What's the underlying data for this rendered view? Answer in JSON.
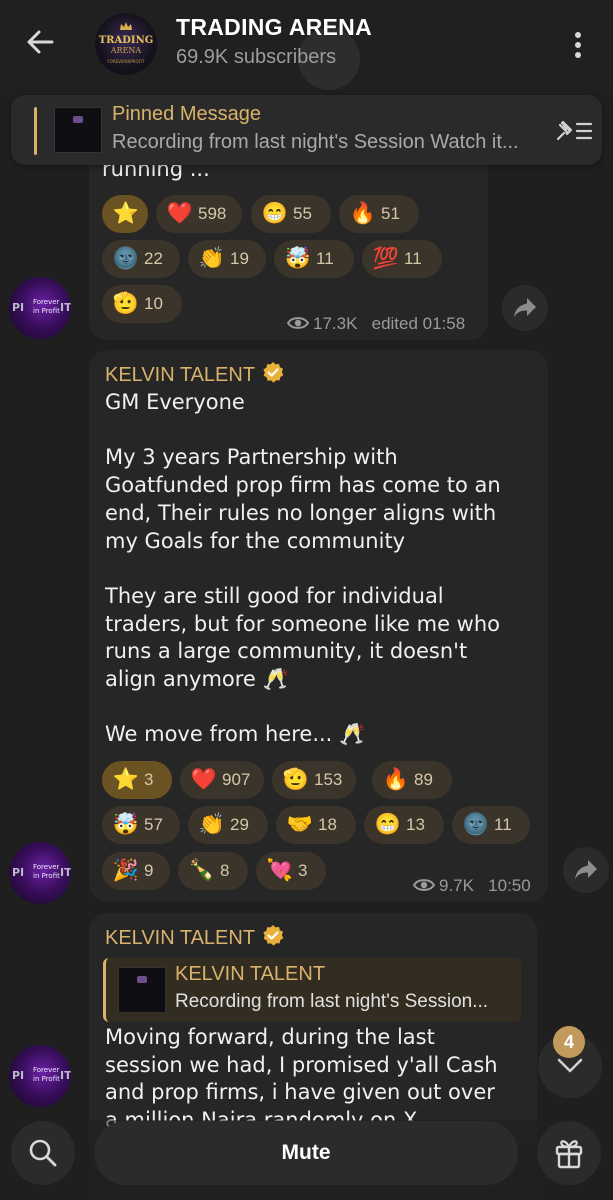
{
  "header": {
    "title": "TRADING ARENA",
    "subscribers": "69.9K subscribers",
    "avatar_lines": [
      "TRADING",
      "ARENA",
      "FOREVERINPROFIT"
    ]
  },
  "pinned": {
    "title": "Pinned Message",
    "text": "Recording from last night's Session  Watch it..."
  },
  "avatar_text": {
    "left": "PI",
    "middle": "Forever in Profit",
    "right": "IT"
  },
  "messages": [
    {
      "text_tail": "running ...",
      "reactions": [
        {
          "emoji": "⭐",
          "count": ""
        },
        {
          "emoji": "❤️",
          "count": "598"
        },
        {
          "emoji": "😁",
          "count": "55"
        },
        {
          "emoji": "🔥",
          "count": "51"
        },
        {
          "emoji": "🌚",
          "count": "22"
        },
        {
          "emoji": "👏",
          "count": "19"
        },
        {
          "emoji": "🤯",
          "count": "11"
        },
        {
          "emoji": "💯",
          "count": "11"
        },
        {
          "emoji": "🫡",
          "count": "10"
        }
      ],
      "views": "17.3K",
      "time": "edited 01:58"
    },
    {
      "sender": "KELVIN TALENT",
      "text": "GM Everyone\n\nMy 3 years Partnership with\nGoatfunded prop firm has come to an\nend, Their rules no longer aligns with\nmy Goals for the community\n\nThey are still good for individual\ntraders, but for someone like me who\nruns a large community, it doesn't\nalign anymore 🥂\n\nWe move from here... 🥂",
      "reactions": [
        {
          "emoji": "⭐",
          "count": "3"
        },
        {
          "emoji": "❤️",
          "count": "907"
        },
        {
          "emoji": "🫡",
          "count": "153"
        },
        {
          "emoji": "🔥",
          "count": "89"
        },
        {
          "emoji": "🤯",
          "count": "57"
        },
        {
          "emoji": "👏",
          "count": "29"
        },
        {
          "emoji": "🤝",
          "count": "18"
        },
        {
          "emoji": "😁",
          "count": "13"
        },
        {
          "emoji": "🌚",
          "count": "11"
        },
        {
          "emoji": "🎉",
          "count": "9"
        },
        {
          "emoji": "🍾",
          "count": "8"
        },
        {
          "emoji": "💘",
          "count": "3"
        }
      ],
      "views": "9.7K",
      "time": "10:50"
    },
    {
      "sender": "KELVIN TALENT",
      "quote": {
        "name": "KELVIN TALENT",
        "text": "Recording from last night's Session..."
      },
      "text": "Moving forward, during the last\nsession we had, I promised y'all Cash\nand prop firms, i have given out over\na million Naira randomly on X"
    }
  ],
  "unread_count": "4",
  "bottom": {
    "mute_label": "Mute"
  },
  "colors": {
    "accent": "#d9b26b",
    "background": "#1f1f1f",
    "bubble": "#262626"
  }
}
